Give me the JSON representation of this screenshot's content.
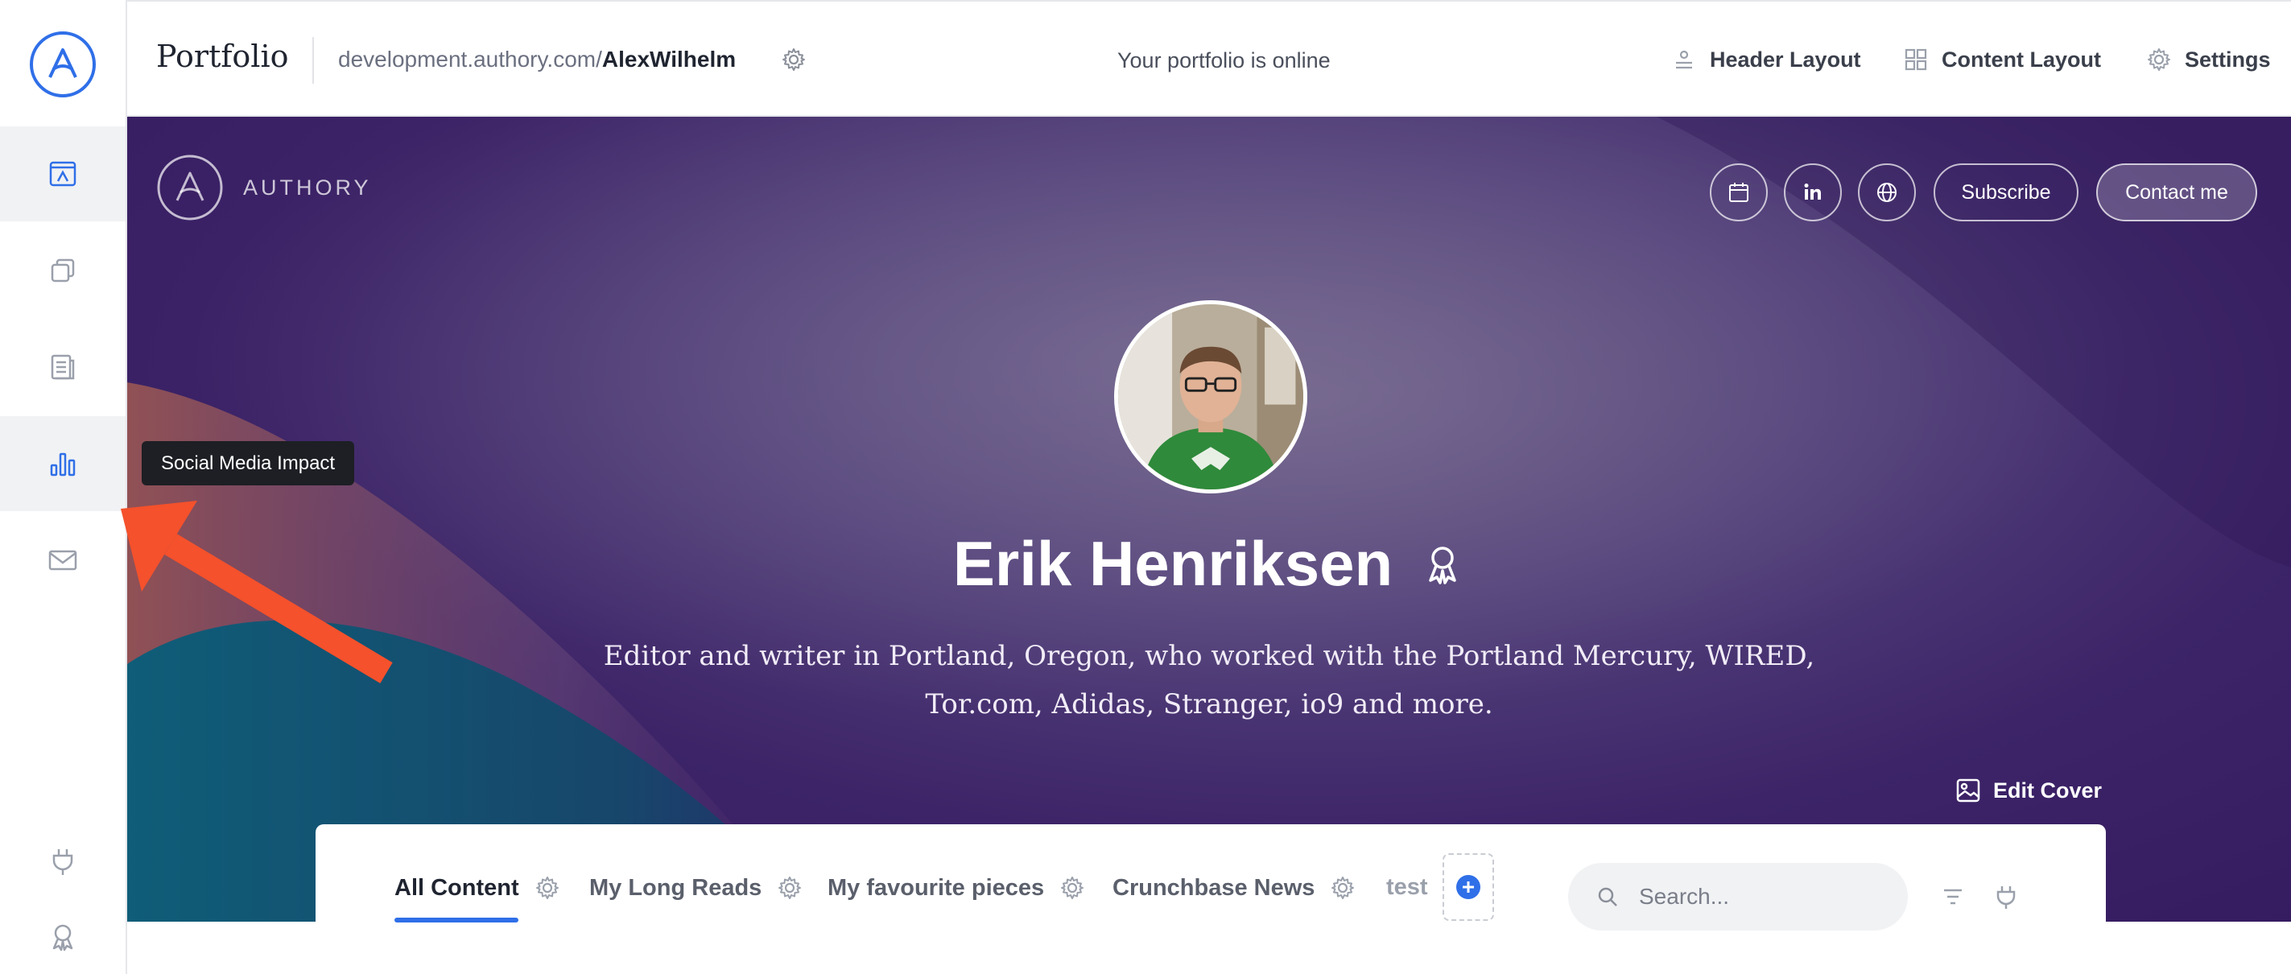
{
  "topbar": {
    "title": "Portfolio",
    "url_domain": "development.authory.com/",
    "url_user": "AlexWilhelm",
    "status": "Your portfolio is online",
    "actions": [
      {
        "label": "Header Layout",
        "icon": "header-layout-icon"
      },
      {
        "label": "Content Layout",
        "icon": "grid-icon"
      },
      {
        "label": "Settings",
        "icon": "gear-icon"
      }
    ]
  },
  "sidebar": {
    "items": [
      {
        "name": "portfolio",
        "icon": "portfolio-icon",
        "active": true
      },
      {
        "name": "collections",
        "icon": "copy-icon",
        "active": false
      },
      {
        "name": "articles",
        "icon": "article-icon",
        "active": false
      },
      {
        "name": "social-media-impact",
        "icon": "bar-chart-icon",
        "active": true
      },
      {
        "name": "newsletter",
        "icon": "mail-icon",
        "active": false
      }
    ],
    "bottom": [
      {
        "name": "integrations",
        "icon": "plug-icon"
      },
      {
        "name": "achievements",
        "icon": "award-icon"
      }
    ]
  },
  "tooltip": {
    "text": "Social Media Impact"
  },
  "hero": {
    "brand": "AUTHORY",
    "subscribe_label": "Subscribe",
    "contact_label": "Contact me",
    "name": "Erik Henriksen",
    "bio": "Editor and writer in Portland, Oregon, who worked with the Portland Mercury, WIRED, Tor.com, Adidas, Stranger, io9 and more.",
    "edit_cover_label": "Edit Cover"
  },
  "tabs": [
    {
      "label": "All Content",
      "active": true
    },
    {
      "label": "My Long Reads",
      "active": false
    },
    {
      "label": "My favourite pieces",
      "active": false
    },
    {
      "label": "Crunchbase News",
      "active": false
    },
    {
      "label": "test",
      "active": false
    }
  ],
  "search": {
    "placeholder": "Search..."
  },
  "colors": {
    "accent": "#2f6fe8",
    "annotation_arrow": "#f4512c",
    "hero_purple": "#3d2468"
  }
}
